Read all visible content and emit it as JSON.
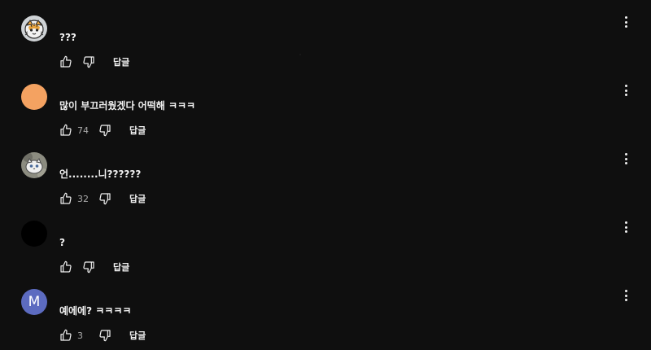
{
  "actions": {
    "reply_label": "답글",
    "like_icon": "thumbs-up-icon",
    "dislike_icon": "thumbs-down-icon",
    "menu_icon": "more-vert-icon"
  },
  "comments": [
    {
      "avatar": {
        "type": "image",
        "description_icon": "tiger-avatar",
        "colors": [
          "#d9d9d9",
          "#e8a33c",
          "#2a2a2a"
        ]
      },
      "text": "???",
      "likes": ""
    },
    {
      "avatar": {
        "type": "solid",
        "color": "#f4a261"
      },
      "text": "많이 부끄러웠겠다 어떡해 ㅋㅋㅋ",
      "likes": "74"
    },
    {
      "avatar": {
        "type": "image",
        "description_icon": "cat-avatar",
        "colors": [
          "#8c8c80",
          "#e8e8e8",
          "#4a6a9a"
        ]
      },
      "text": "언........니??????",
      "likes": "32"
    },
    {
      "avatar": {
        "type": "solid",
        "color": "#000000"
      },
      "text": "?",
      "likes": ""
    },
    {
      "avatar": {
        "type": "letter",
        "letter": "M",
        "color": "#5c6bc0"
      },
      "text": "예에에? ㅋㅋㅋㅋ",
      "likes": "3"
    }
  ]
}
